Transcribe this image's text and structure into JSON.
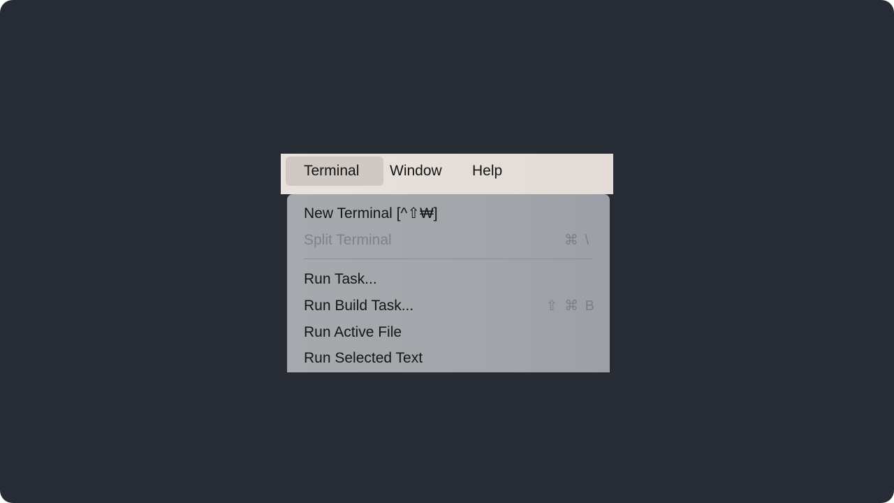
{
  "menubar": {
    "items": [
      {
        "label": "Terminal",
        "active": true
      },
      {
        "label": "Window"
      },
      {
        "label": "Help"
      }
    ]
  },
  "dropdown": {
    "items": [
      {
        "label": "New Terminal [^⇧₩]",
        "enabled": true
      },
      {
        "label": "Split Terminal",
        "enabled": false,
        "shortcut": [
          "⌘",
          "\\"
        ]
      },
      {
        "label": "Run Task...",
        "enabled": true
      },
      {
        "label": "Run Build Task...",
        "enabled": true,
        "shortcut": [
          "⇧",
          "⌘",
          "B"
        ]
      },
      {
        "label": "Run Active File",
        "enabled": true
      },
      {
        "label": "Run Selected Text",
        "enabled": true
      }
    ]
  },
  "colors": {
    "background": "#272b34",
    "menubar": "#e7dfd9",
    "menubar_active": "#cfc8c3",
    "dropdown": "#a4a7ac",
    "text": "#141414",
    "disabled_text": "#7f8288"
  }
}
